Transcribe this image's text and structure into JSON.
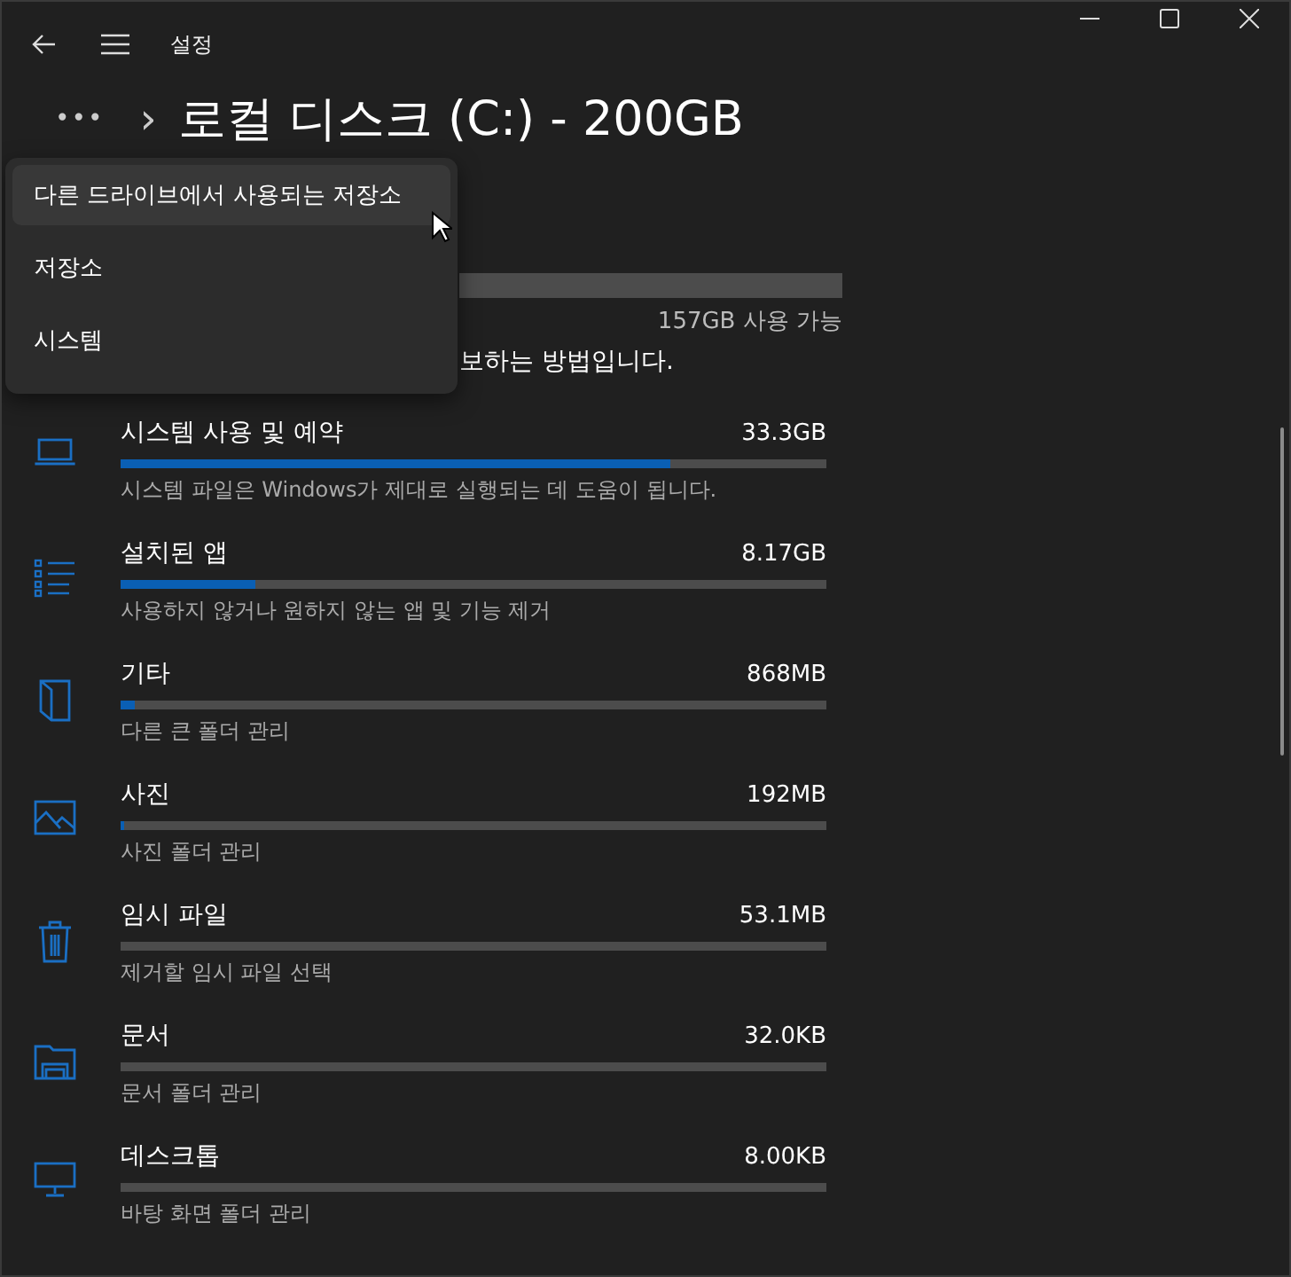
{
  "window": {
    "title": "설정"
  },
  "breadcrumb": {
    "overflow": "•••",
    "separator": "›",
    "title": "로컬 디스크 (C:) - 200GB"
  },
  "disk": {
    "free": "157GB 사용 가능",
    "description": "보하는 방법입니다."
  },
  "menu": [
    {
      "label": "다른 드라이브에서 사용되는 저장소",
      "hovered": true
    },
    {
      "label": "저장소",
      "hovered": false
    },
    {
      "label": "시스템",
      "hovered": false
    }
  ],
  "categories": [
    {
      "kind": "laptop",
      "name": "시스템 사용 및 예약",
      "size": "33.3GB",
      "level": 0.78,
      "description": "시스템 파일은 Windows가 제대로 실행되는 데 도움이 됩니다."
    },
    {
      "kind": "list",
      "name": "설치된 앱",
      "size": "8.17GB",
      "level": 0.19,
      "description": "사용하지 않거나 원하지 않는 앱 및 기능 제거"
    },
    {
      "kind": "file",
      "name": "기타",
      "size": "868MB",
      "level": 0.02,
      "description": "다른 큰 폴더 관리"
    },
    {
      "kind": "image",
      "name": "사진",
      "size": "192MB",
      "level": 0.005,
      "description": "사진 폴더 관리"
    },
    {
      "kind": "trash",
      "name": "임시 파일",
      "size": "53.1MB",
      "description": "제거할 임시 파일 선택"
    },
    {
      "kind": "folder",
      "name": "문서",
      "size": "32.0KB",
      "description": "문서 폴더 관리"
    },
    {
      "kind": "monitor",
      "name": "데스크톱",
      "size": "8.00KB",
      "description": "바탕 화면 폴더 관리"
    }
  ]
}
